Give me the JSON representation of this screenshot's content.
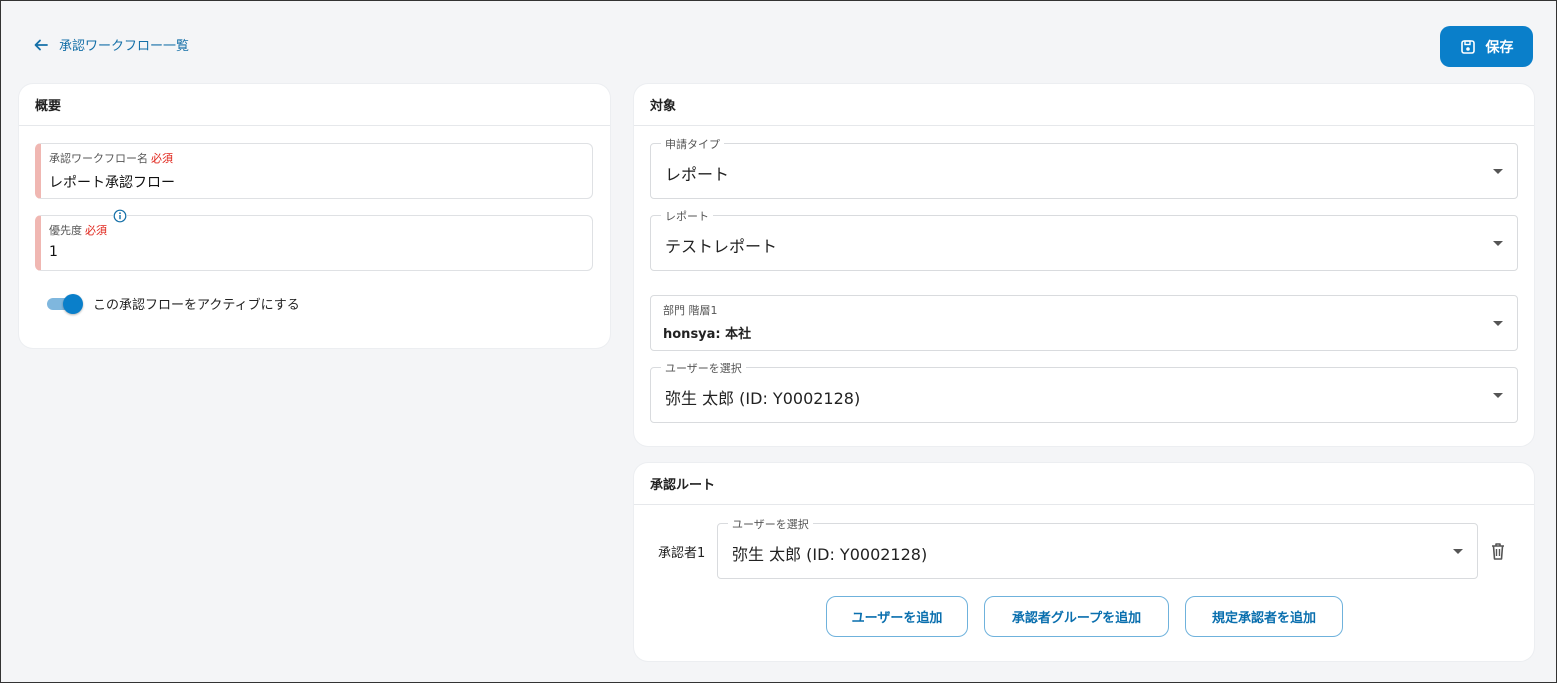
{
  "nav": {
    "back_label": "承認ワークフロー一覧"
  },
  "toolbar": {
    "save_label": "保存"
  },
  "overview": {
    "title": "概要",
    "name_field": {
      "label": "承認ワークフロー名",
      "required": "必須",
      "value": "レポート承認フロー"
    },
    "priority_field": {
      "label": "優先度",
      "required": "必須",
      "value": "1"
    },
    "active_toggle": {
      "label": "この承認フローをアクティブにする",
      "checked": true
    }
  },
  "target": {
    "title": "対象",
    "application_type": {
      "label": "申請タイプ",
      "value": "レポート"
    },
    "report": {
      "label": "レポート",
      "value": "テストレポート"
    },
    "department": {
      "label": "部門 階層1",
      "value": "honsya: 本社"
    },
    "user": {
      "label": "ユーザーを選択",
      "value": "弥生 太郎 (ID: Y0002128)"
    }
  },
  "route": {
    "title": "承認ルート",
    "approvers": [
      {
        "label": "承認者1",
        "select_label": "ユーザーを選択",
        "value": "弥生 太郎 (ID: Y0002128)"
      }
    ],
    "buttons": {
      "add_user": "ユーザーを追加",
      "add_group": "承認者グループを追加",
      "add_default": "規定承認者を追加"
    }
  },
  "colors": {
    "accent": "#0a7fca",
    "required": "#e0241a",
    "required_bar": "#f0b7b2",
    "background": "#f4f5f7"
  }
}
